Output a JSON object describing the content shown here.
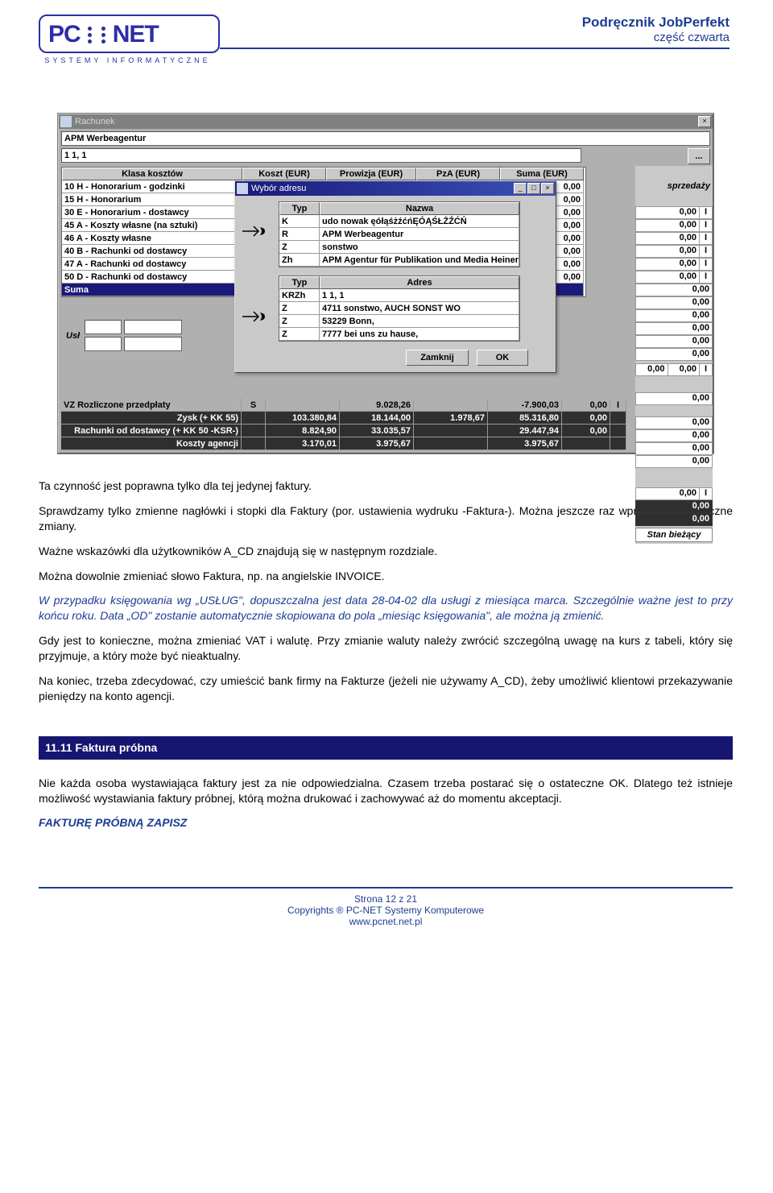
{
  "header": {
    "logo_sub": "SYSTEMY  INFORMATYCZNE",
    "title": "Podręcznik JobPerfekt",
    "subtitle": "część czwarta"
  },
  "screenshot": {
    "main_title": "Rachunek",
    "company": "APM Werbeagentur",
    "addr_line": "1 1, 1",
    "ellipsis": "...",
    "cost_headers": [
      "Klasa kosztów",
      "Koszt (EUR)",
      "Prowizja (EUR)",
      "PzA (EUR)",
      "Suma (EUR)"
    ],
    "cost_rows": [
      {
        "label": "10 H - Honorarium - godzinki",
        "suma": "0,00"
      },
      {
        "label": "15 H - Honorarium",
        "suma": "0,00"
      },
      {
        "label": "30 E - Honorarium - dostawcy",
        "suma": "0,00"
      },
      {
        "label": "45 A - Koszty własne (na sztuki)",
        "suma": "0,00"
      },
      {
        "label": "46 A - Koszty własne",
        "suma": "0,00"
      },
      {
        "label": "40 B - Rachunki od dostawcy",
        "suma": "0,00"
      },
      {
        "label": "47 A - Rachunki od dostawcy",
        "suma": "0,00"
      },
      {
        "label": "50 D - Rachunki od dostawcy",
        "suma": "0,00"
      }
    ],
    "suma_label": "Suma",
    "usl_label": "Usł",
    "dialog_title": "Wybór adresu",
    "name_headers": [
      "Typ",
      "Nazwa"
    ],
    "name_rows": [
      {
        "typ": "K",
        "nazwa": "udo nowak ęółąśżźćńĘÓĄŚŁŻŹĆŃ"
      },
      {
        "typ": "R",
        "nazwa": "APM Werbeagentur"
      },
      {
        "typ": "Z",
        "nazwa": "sonstwo"
      },
      {
        "typ": "Zh",
        "nazwa": "APM Agentur für Publikation und Media Heiner Gr"
      }
    ],
    "addr_headers": [
      "Typ",
      "Adres"
    ],
    "addr_rows": [
      {
        "typ": "KRZh",
        "adres": "1 1, 1"
      },
      {
        "typ": "Z",
        "adres": "4711 sonstwo, AUCH SONST WO"
      },
      {
        "typ": "Z",
        "adres": "53229 Bonn,"
      },
      {
        "typ": "Z",
        "adres": "7777 bei uns zu hause,"
      }
    ],
    "btn_close": "Zamknij",
    "btn_ok": "OK",
    "right_label_sprzedazy": "sprzedaży",
    "right_vals": [
      "0,00",
      "0,00",
      "0,00",
      "0,00",
      "0,00",
      "0,00"
    ],
    "right_zeros_grp2": [
      "0,00",
      "0,00",
      "0,00",
      "0,00",
      "0,00",
      "0,00"
    ],
    "right_pair": [
      "0,00",
      "0,00"
    ],
    "right_single": "0,00",
    "right_last_grp": [
      "0,00",
      "0,00",
      "0,00",
      "0,00"
    ],
    "stan": "Stan bieżący",
    "bottom_rows": [
      {
        "label": "VZ Rozliczone przedpłaty",
        "c1": "S",
        "c2": "",
        "c3": "9.028,26",
        "c4": "",
        "c5": "-7.900,03",
        "c6": "0,00",
        "c7": "I"
      },
      {
        "label": "Zysk (+ KK 55)",
        "c1": "",
        "c2": "103.380,84",
        "c3": "18.144,00",
        "c4": "1.978,67",
        "c5": "85.316,80",
        "c6": "0,00",
        "c7": "",
        "dark": true
      },
      {
        "label": "Rachunki od dostawcy (+ KK 50 -KSR-)",
        "c1": "",
        "c2": "8.824,90",
        "c3": "33.035,57",
        "c4": "",
        "c5": "29.447,94",
        "c6": "0,00",
        "c7": "",
        "dark": true
      },
      {
        "label": "Koszty agencji",
        "c1": "",
        "c2": "3.170,01",
        "c3": "3.975,67",
        "c4": "",
        "c5": "3.975,67",
        "c6": "",
        "c7": "",
        "dark": true
      }
    ]
  },
  "content": {
    "p1": "Ta czynność jest poprawna tylko dla tej jedynej faktury.",
    "p2": "Sprawdzamy tylko zmienne nagłówki i stopki dla Faktury (por. ustawienia wydruku -Faktura-). Można jeszcze raz wprowadzić konieczne zmiany.",
    "p3": "Ważne wskazówki dla użytkowników A_CD znajdują się w następnym rozdziale.",
    "p4": "Można dowolnie zmieniać słowo  Faktura, np. na angielskie INVOICE.",
    "note": "W przypadku księgowania wg „USŁUG\", dopuszczalna jest data 28-04-02 dla usługi z miesiąca marca. Szczególnie ważne jest to przy końcu roku. Data „OD\" zostanie automatycznie skopiowana do pola „miesiąc księgowania\", ale można ją zmienić.",
    "p5": "Gdy jest to konieczne, można zmieniać VAT i walutę. Przy zmianie waluty należy zwrócić szczególną uwagę na kurs z tabeli, który się przyjmuje, a który może być nieaktualny.",
    "p6": "Na koniec, trzeba zdecydować, czy umieścić bank firmy na Fakturze (jeżeli nie używamy A_CD), żeby umożliwić klientowi przekazywanie pieniędzy na konto agencji.",
    "section": "11.11  Faktura próbna",
    "p7": "Nie każda osoba wystawiająca faktury jest za nie odpowiedzialna. Czasem trzeba postarać się o ostateczne OK. Dlatego też istnieje możliwość wystawiania faktury próbnej, którą można drukować i zachowywać aż do momentu akceptacji.",
    "save": "FAKTURĘ PRÓBNĄ ZAPISZ",
    "footer1": "Strona 12 z 21",
    "footer2": "Copyrights ® PC-NET Systemy Komputerowe",
    "footer3": "www.pcnet.net.pl"
  }
}
